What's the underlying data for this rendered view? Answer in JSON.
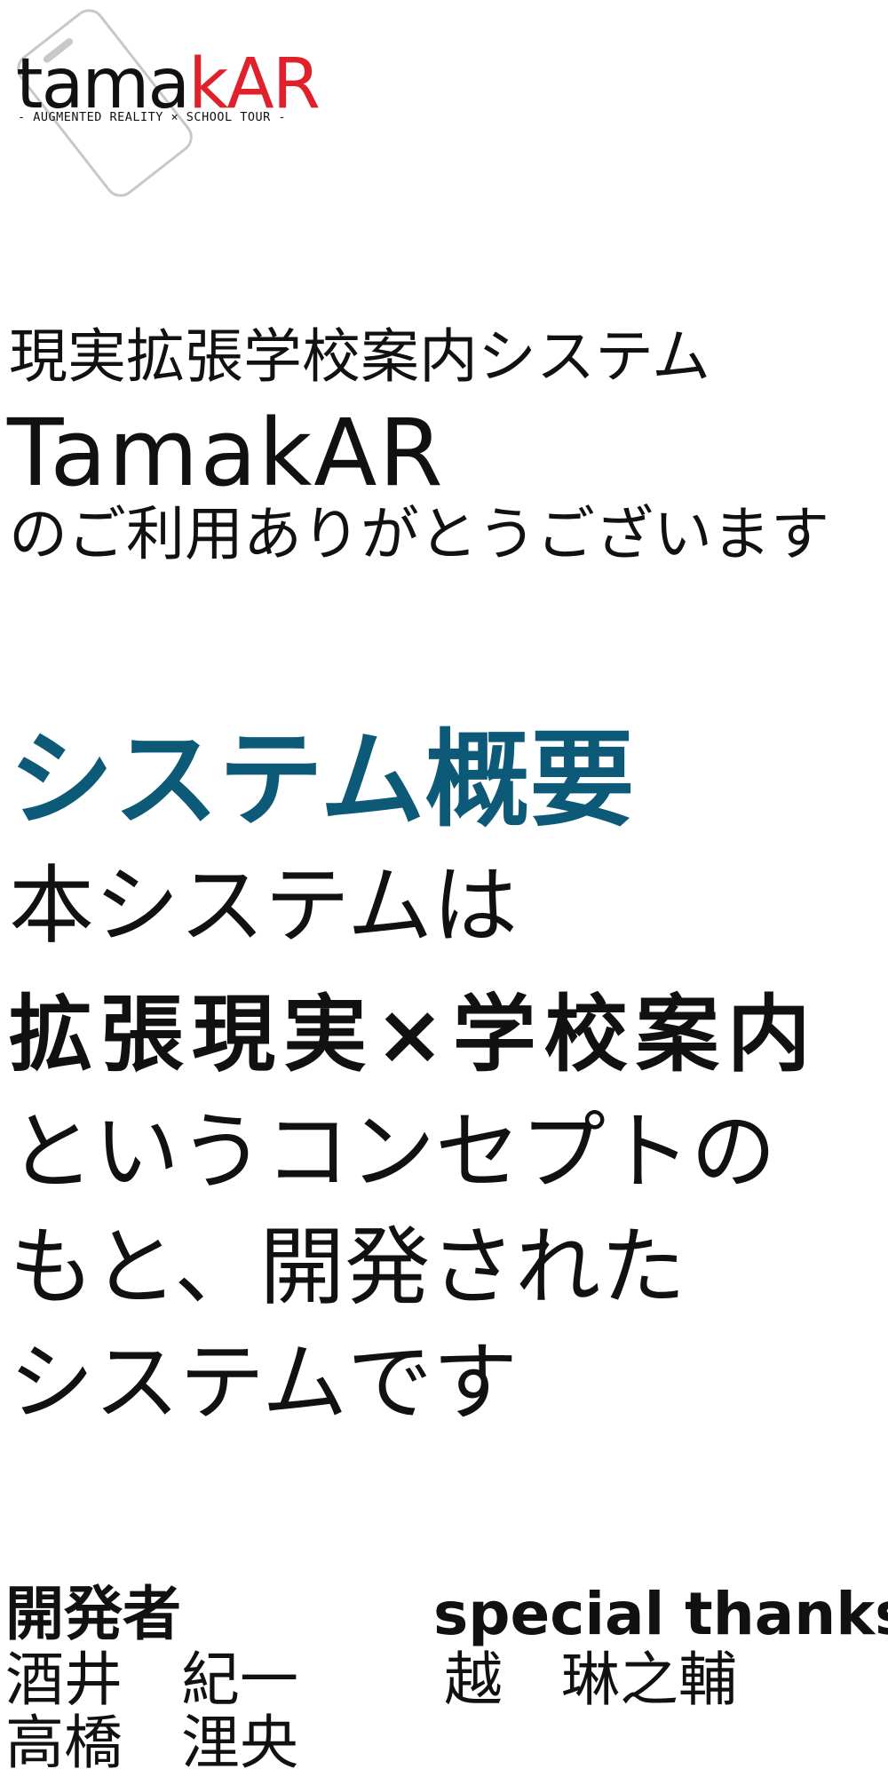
{
  "logo": {
    "wordmark_part1": "tama",
    "wordmark_part2": "kAR",
    "tagline": "- AUGMENTED REALITY × SCHOOL TOUR -",
    "colors": {
      "dark": "#111111",
      "accent": "#e0202b",
      "phone_outline": "#c8c8c8"
    }
  },
  "intro": {
    "line1": "現実拡張学校案内システム",
    "product": "TamakAR",
    "line3": "のご利用ありがとうございます"
  },
  "overview": {
    "heading": "システム概要",
    "heading_color": "#0d5a78",
    "line1": "本システムは",
    "concept": "拡張現実×学校案内",
    "line3": "というコンセプトの",
    "line4": "もと、開発された",
    "line5": "システムです"
  },
  "credits": {
    "developers_heading": "開発者",
    "developers": [
      "酒井　紀一",
      "高橋　浬央"
    ],
    "thanks_heading": "special thanks",
    "thanks": [
      "越　琳之輔"
    ]
  }
}
